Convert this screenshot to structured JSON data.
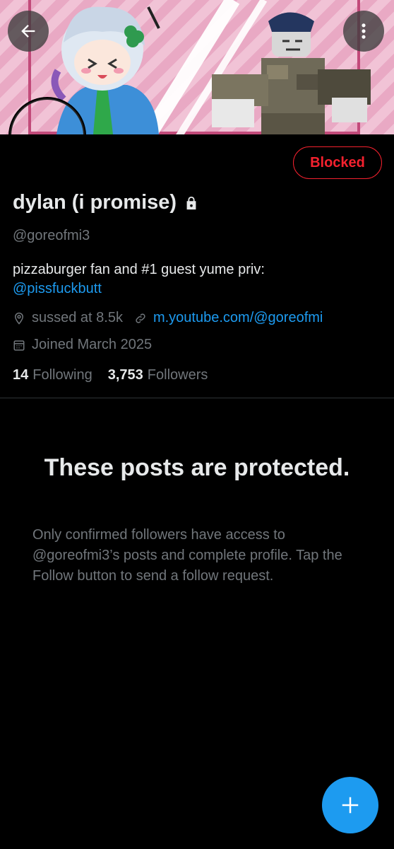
{
  "header": {
    "back_icon": "arrow-left-icon",
    "more_icon": "more-vertical-icon"
  },
  "profile": {
    "display_name": "dylan (i promise)",
    "protected_icon": "lock-icon",
    "handle": "@goreofmi3",
    "bio_text": "pizzaburger fan and #1 guest yume priv:",
    "bio_mention": "@pissfuckbutt",
    "location": "sussed at 8.5k",
    "link": "m.youtube.com/@goreofmi",
    "joined": "Joined March 2025",
    "following_count": "14",
    "following_label": "Following",
    "followers_count": "3,753",
    "followers_label": "Followers",
    "blocked_label": "Blocked"
  },
  "protected_notice": {
    "title": "These posts are protected.",
    "description": "Only confirmed followers have access to @goreofmi3’s posts and complete profile. Tap the Follow button to send a follow request."
  },
  "fab": {
    "icon": "plus-icon"
  },
  "colors": {
    "accent": "#1d9bf0",
    "danger": "#f4212e",
    "background": "#000000",
    "muted_text": "#71767b"
  }
}
